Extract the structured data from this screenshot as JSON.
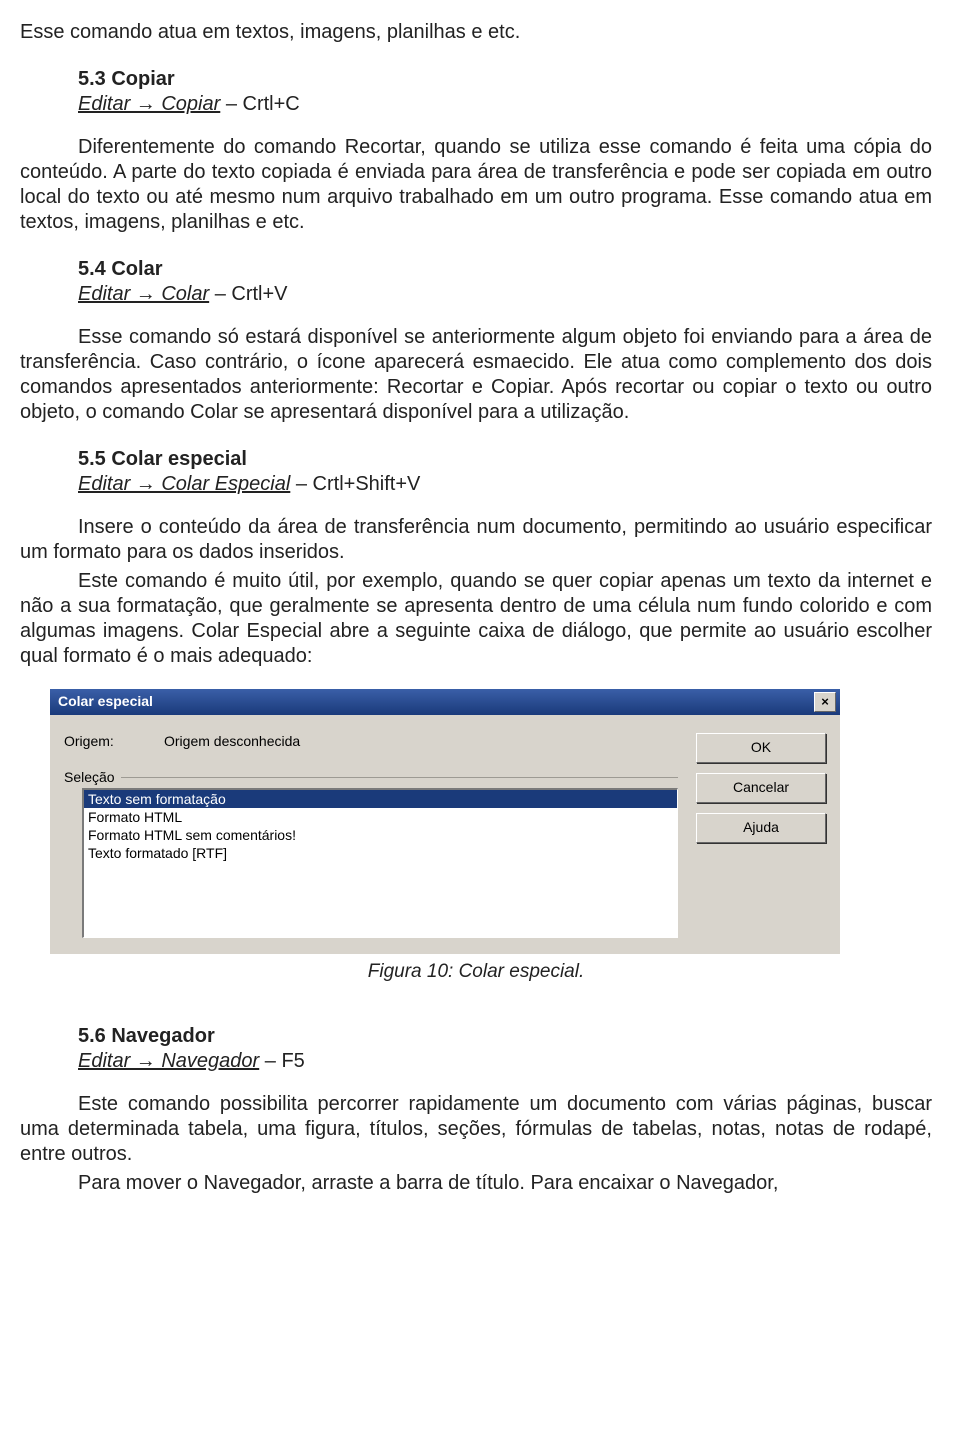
{
  "doc": {
    "p1": "Esse comando atua em textos, imagens, planilhas e etc.",
    "s53_heading": "5.3 Copiar",
    "s53_menu": "Editar → Copiar",
    "s53_shortcut": " – Crtl+C",
    "s53_p1": "Diferentemente do comando Recortar, quando se utiliza esse comando é feita uma cópia do conteúdo. A parte do texto copiada é enviada para área de transferência e pode ser copiada em outro local do texto ou até mesmo num arquivo trabalhado em um outro programa. Esse comando atua em textos, imagens, planilhas e etc.",
    "s54_heading": "5.4 Colar",
    "s54_menu": "Editar → Colar",
    "s54_shortcut": " – Crtl+V",
    "s54_p1": "Esse comando só estará disponível se anteriormente algum objeto foi enviando para a área de transferência. Caso contrário, o ícone aparecerá esmaecido. Ele atua como complemento dos dois comandos apresentados anteriormente: Recortar e Copiar. Após recortar ou copiar o texto ou outro objeto, o comando Colar se apresentará disponível para a utilização.",
    "s55_heading": "5.5 Colar especial",
    "s55_menu": "Editar → Colar Especial",
    "s55_shortcut": " – Crtl+Shift+V",
    "s55_p1": "Insere o conteúdo da área de transferência num documento, permitindo ao usuário especificar um formato para os dados inseridos.",
    "s55_p2": "Este comando é muito útil, por exemplo, quando se quer copiar apenas um texto da internet e não a sua formatação, que geralmente se apresenta dentro de uma célula num fundo colorido e com algumas imagens. Colar Especial abre a seguinte caixa de diálogo, que permite ao usuário escolher qual formato é o mais adequado:",
    "figure_caption": "Figura 10: Colar especial.",
    "s56_heading": "5.6 Navegador",
    "s56_menu": "Editar → Navegador",
    "s56_shortcut": " – F5",
    "s56_p1": "Este comando possibilita percorrer rapidamente um documento com várias páginas, buscar uma determinada tabela, uma figura, títulos, seções, fórmulas de tabelas, notas, notas de rodapé, entre outros.",
    "s56_p2": "Para mover o Navegador, arraste a barra de título. Para encaixar o Navegador,"
  },
  "dialog": {
    "title": "Colar especial",
    "origin_label": "Origem:",
    "origin_value": "Origem desconhecida",
    "selection_label": "Seleção",
    "options": [
      "Texto sem formatação",
      "Formato HTML",
      "Formato HTML sem comentários!",
      "Texto formatado [RTF]"
    ],
    "buttons": {
      "ok": "OK",
      "cancel": "Cancelar",
      "help": "Ajuda"
    },
    "close": "×"
  }
}
